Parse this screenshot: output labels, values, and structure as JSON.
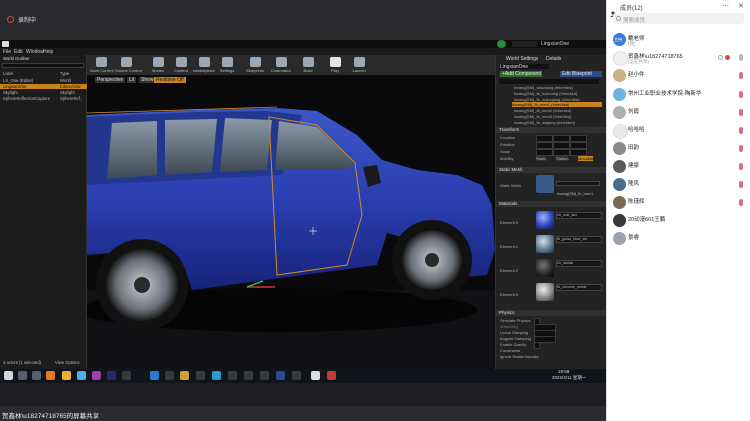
{
  "meeting": {
    "recording_label": "录制中",
    "share_label": "贺鑫林\\u18274718765的屏幕共享"
  },
  "ue": {
    "tab_title": "LingxianOne",
    "menu": [
      "File",
      "Edit",
      "Window",
      "Help"
    ],
    "toolbar": [
      "Save Current",
      "Source Control",
      "Modes",
      "Content",
      "Marketplace",
      "Settings",
      "Blueprints",
      "Cinematics",
      "Build",
      "Play",
      "Launch"
    ],
    "outliner": {
      "search_label": "World Outliner",
      "col_label": "Label",
      "col_type": "Type",
      "rows": [
        {
          "label": "LX_One (Editor)",
          "type": "World"
        },
        {
          "label": "LingxianOne",
          "type": "EditorActor",
          "selected": true
        },
        {
          "label": "Skylight",
          "type": "Skylight"
        },
        {
          "label": "SphereReflectionCapture",
          "type": "SphereRef.."
        }
      ],
      "status": "4 actors (1 selected)",
      "view_options": "View Options"
    },
    "viewport": {
      "perspective": "Perspective",
      "lit": "Lit",
      "show": "Show",
      "realtime": "Realtime Off"
    },
    "details": {
      "tabs": [
        "World Settings",
        "Details"
      ],
      "actor_name": "LingxianOne",
      "add_component": "+Add Component",
      "edit_blueprint": "Edit Blueprint",
      "components": [
        "lxcang(SM)_xiaoxiang (Inherited)",
        "lxcang(SM)_fb_luoluning (Inherited)",
        "lxcang(SM)_fb_luoluqiang (Inherited)",
        "lxcang(SM)_fb_men1 (Inherited)",
        "lxcang(SM)_fb_men2 (Inherited)",
        "lxcang(SM)_fb_men3 (Inherited)",
        "lxcang(SM)_fb_waiping (Inherited)"
      ],
      "transform": "Transform",
      "location": "Location",
      "rotation": "Rotation",
      "scale": "Scale",
      "mobility": "Mobility",
      "mob_options": [
        "Static",
        "Station",
        "Movable"
      ],
      "static_mesh_title": "Static Mesh",
      "static_mesh_label": "Static Mesh",
      "static_mesh_value": "lxcang(SM)_fb_men1",
      "materials": "Materials",
      "elements": [
        "Element 0",
        "Element 1",
        "Element 2",
        "Element 3"
      ],
      "element_values": [
        "ch_mat_lan",
        "fb_glass_blue_xin",
        "ch_lanlab",
        "fb_chrome_metal"
      ],
      "physics": "Physics",
      "physics_props": [
        "Simulate Physics",
        "MassInKg",
        "Linear Damping",
        "Angular Damping",
        "Enable Gravity",
        "Constraints",
        "Ignore Radial Impulse"
      ]
    },
    "taskbar": {
      "time": "19:58",
      "date": "2022/4/11 星期一"
    }
  },
  "panel": {
    "title": "成员(12)",
    "search_placeholder": "搜索成员",
    "members": [
      {
        "name": "戴老师",
        "sub": "(我)",
        "avatar": "#3a7bd5",
        "badge": "主持"
      },
      {
        "name": "贺鑫林\\u18274718765",
        "sub": "(正在共享)",
        "avatar": "#f5f5f5"
      },
      {
        "name": "赵小件",
        "sub": "",
        "avatar": "#c9b08a"
      },
      {
        "name": "常州工业职业技术学院-陶新华",
        "sub": "",
        "avatar": "#6bb3e0"
      },
      {
        "name": "刘霞",
        "sub": "",
        "avatar": "#b0b0b0"
      },
      {
        "name": "哈哈哈",
        "sub": "",
        "avatar": "#e8e8e8"
      },
      {
        "name": "田韵",
        "sub": "",
        "avatar": "#8a8a8a"
      },
      {
        "name": "建豪",
        "sub": "",
        "avatar": "#5a5a5a"
      },
      {
        "name": "隆风",
        "sub": "",
        "avatar": "#4d6b8a"
      },
      {
        "name": "陈瑾辉",
        "sub": "",
        "avatar": "#7a6a55"
      },
      {
        "name": "20动漫661王鹏",
        "sub": "",
        "avatar": "#3a3a3a"
      },
      {
        "name": "景睿",
        "sub": "",
        "avatar": "#9aa3ad"
      }
    ]
  }
}
